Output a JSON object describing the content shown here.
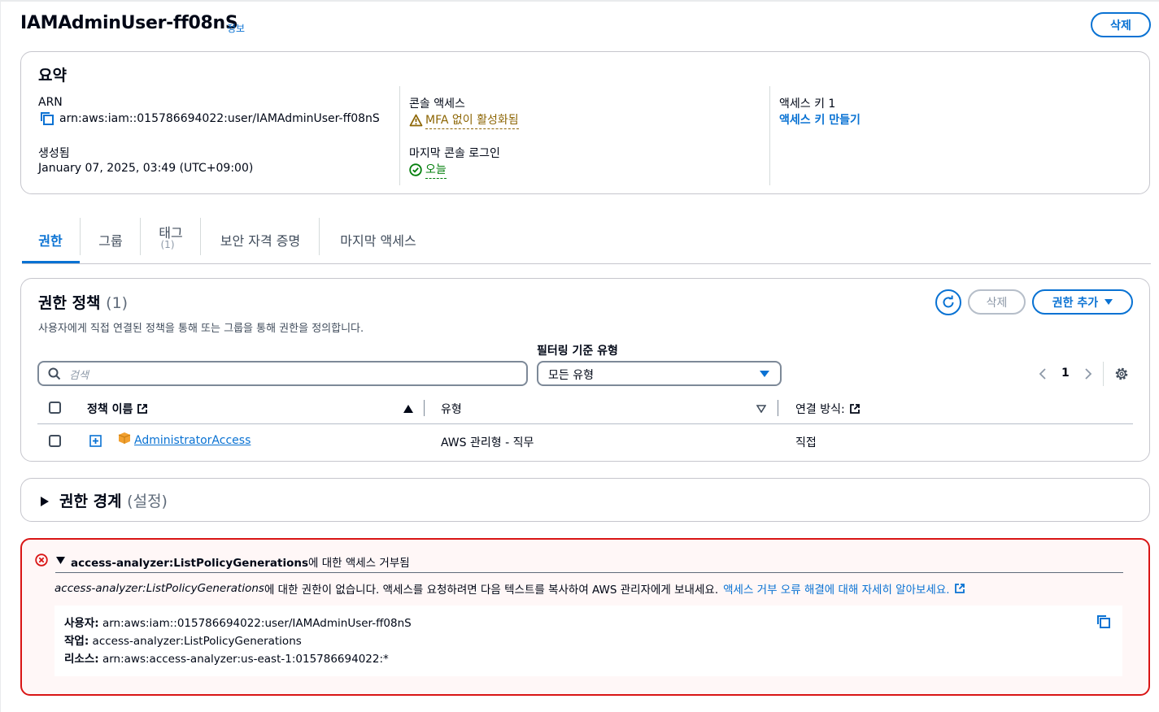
{
  "header": {
    "title": "IAMAdminUser-ff08nS",
    "info_label": "정보",
    "delete_label": "삭제"
  },
  "summary": {
    "title": "요약",
    "arn_label": "ARN",
    "arn_value": "arn:aws:iam::015786694022:user/IAMAdminUser-ff08nS",
    "created_label": "생성됨",
    "created_value": "January 07, 2025, 03:49 (UTC+09:00)",
    "console_access_label": "콘솔 액세스",
    "console_access_value": "MFA 없이 활성화됨",
    "last_login_label": "마지막 콘솔 로그인",
    "last_login_value": "오늘",
    "access_key_label": "액세스 키 1",
    "create_access_key": "액세스 키 만들기"
  },
  "tabs": [
    {
      "label": "권한",
      "active": true
    },
    {
      "label": "그룹",
      "active": false
    },
    {
      "label": "태그",
      "count": "(1)",
      "active": false
    },
    {
      "label": "보안 자격 증명",
      "active": false
    },
    {
      "label": "마지막 액세스",
      "active": false
    }
  ],
  "permissions": {
    "title": "권한 정책",
    "count": "(1)",
    "description": "사용자에게 직접 연결된 정책을 통해 또는 그룹을 통해 권한을 정의합니다.",
    "refresh_icon": "refresh-icon",
    "delete_label": "삭제",
    "add_label": "권한 추가",
    "filter_label": "필터링 기준 유형",
    "search_placeholder": "검색",
    "filter_value": "모든 유형",
    "page_number": "1",
    "columns": [
      "정책 이름",
      "유형",
      "연결 방식:"
    ],
    "rows": [
      {
        "name": "AdministratorAccess",
        "type": "AWS 관리형 - 직무",
        "attached": "직접"
      }
    ]
  },
  "boundary": {
    "title": "권한 경계",
    "state": "(설정)"
  },
  "error": {
    "heading_code": "access-analyzer:ListPolicyGenerations",
    "heading_suffix": "에 대한 액세스 거부됨",
    "body_code": "access-analyzer:ListPolicyGenerations",
    "body_text": "에 대한 권한이 없습니다. 액세스를 요청하려면 다음 텍스트를 복사하여 AWS 관리자에게 보내세요.",
    "learn_more": "액세스 거부 오류 해결에 대해 자세히 알아보세요.",
    "user_label": "사용자:",
    "user_value": "arn:aws:iam::015786694022:user/IAMAdminUser-ff08nS",
    "action_label": "작업:",
    "action_value": "access-analyzer:ListPolicyGenerations",
    "resource_label": "리소스:",
    "resource_value": "arn:aws:access-analyzer:us-east-1:015786694022:*"
  },
  "colors": {
    "accent": "#0972d3",
    "error": "#d91515",
    "warning": "#8d6605",
    "success": "#037f0c",
    "policy_icon": "#f2a02f"
  }
}
